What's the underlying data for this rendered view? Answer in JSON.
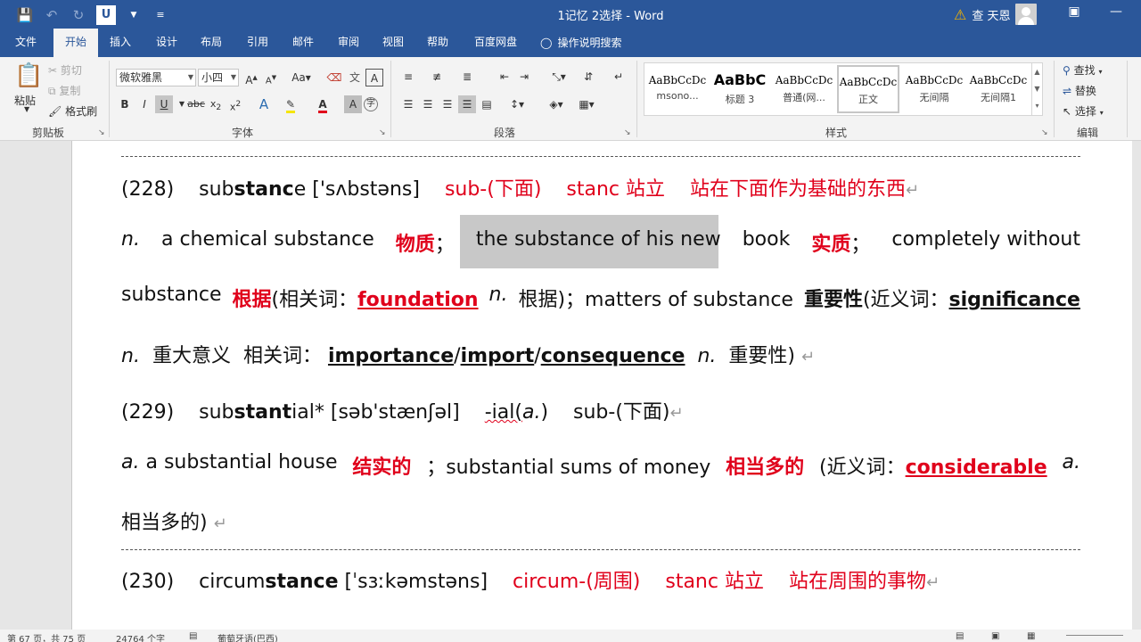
{
  "titlebar": {
    "doc_title": "1记忆 2选择 - Word",
    "user_name": "查 天恩",
    "qat_u": "U"
  },
  "tabs": [
    "文件",
    "开始",
    "插入",
    "设计",
    "布局",
    "引用",
    "邮件",
    "审阅",
    "视图",
    "帮助",
    "百度网盘"
  ],
  "tellme": "操作说明搜索",
  "ribbon": {
    "clipboard": {
      "paste": "粘贴",
      "cut": "剪切",
      "copy": "复制",
      "format_painter": "格式刷",
      "label": "剪贴板"
    },
    "font": {
      "name": "微软雅黑",
      "size": "小四",
      "label": "字体"
    },
    "paragraph": {
      "label": "段落"
    },
    "styles": {
      "label": "样式",
      "items": [
        {
          "sample": "AaBbCcDc",
          "name": "msono..."
        },
        {
          "sample": "AaBbC",
          "name": "标题 3"
        },
        {
          "sample": "AaBbCcDc",
          "name": "普通(网..."
        },
        {
          "sample": "AaBbCcDc",
          "name": "正文"
        },
        {
          "sample": "AaBbCcDc",
          "name": "无间隔"
        },
        {
          "sample": "AaBbCcDc",
          "name": "无间隔1"
        }
      ]
    },
    "editing": {
      "find": "查找",
      "replace": "替换",
      "select": "选择",
      "label": "编辑"
    }
  },
  "doc": {
    "l1": {
      "num": "(228)",
      "w_a": "sub",
      "w_b": "stanc",
      "w_c": "e",
      "ipa": "['sʌbstəns]",
      "m1": "sub-(下面)",
      "m2": "stanc 站立",
      "m3": "站在下面作为基础的东西"
    },
    "l2": {
      "pos": "n.",
      "t1": "a chemical substance",
      "r1": "物质",
      "semi": "；",
      "sel": "the substance of his new",
      "t2": "book",
      "r2": "实质",
      "semi2": "；",
      "t3": "completely without"
    },
    "l3": {
      "t1": "substance",
      "r1": "根据",
      "p1": "(相关词：",
      "w1": "foundation",
      "pos": "n.",
      "p2": "根据)；matters of substance",
      "b1": "重要性",
      "p3": "(近义词：",
      "w2": "significance"
    },
    "l4": {
      "pos": "n.",
      "t1": "重大意义",
      "t2": "相关词：",
      "w1": "importance",
      "w2": "import",
      "w3": "consequence",
      "pos2": "n.",
      "t3": "重要性)"
    },
    "l5": {
      "num": "(229)",
      "w_a": "sub",
      "w_b": "stant",
      "w_c": "ial*",
      "ipa": "[səb'stænʃəl]",
      "m1": "-ial(",
      "m1a": "a.",
      "m1b": ")",
      "m2": "sub-(下面)"
    },
    "l6": {
      "pos": "a.",
      "t1": "a substantial house",
      "r1": "结实的",
      "t2": "；substantial sums of money",
      "r2": "相当多的",
      "t3": "(近义词：",
      "w1": "considerable",
      "pos2": "a."
    },
    "l7": {
      "t1": "相当多的)"
    },
    "l8": {
      "num": "(230)",
      "w_a": "circum",
      "w_b": "stance",
      "ipa": "[ˈsɜːkəmstəns]",
      "m1": "circum-(周围)",
      "m2": "stanc 站立",
      "m3": "站在周围的事物"
    }
  },
  "status": {
    "page": "第 67 页，共 75 页",
    "words": "24764 个字",
    "lang": "葡萄牙语(巴西)"
  }
}
